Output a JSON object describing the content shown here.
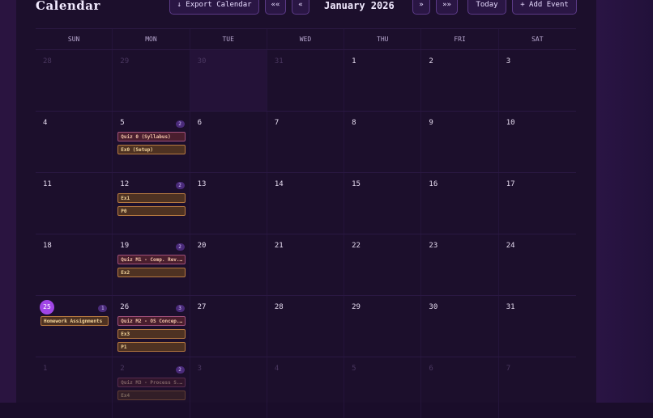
{
  "header": {
    "title": "Calendar",
    "export_label": "↓ Export Calendar",
    "prev_year_label": "««",
    "prev_month_label": "«",
    "month_label": "January 2026",
    "next_month_label": "»",
    "next_year_label": "»»",
    "today_label": "Today",
    "add_event_label": "+ Add Event"
  },
  "weekdays": [
    "SUN",
    "MON",
    "TUE",
    "WED",
    "THU",
    "FRI",
    "SAT"
  ],
  "weeks": [
    [
      "28",
      "29",
      "30",
      "31",
      "1",
      "2",
      "3"
    ],
    [
      "4",
      "5",
      "6",
      "7",
      "8",
      "9",
      "10"
    ],
    [
      "11",
      "12",
      "13",
      "14",
      "15",
      "16",
      "17"
    ],
    [
      "18",
      "19",
      "20",
      "21",
      "22",
      "23",
      "24"
    ],
    [
      "25",
      "26",
      "27",
      "28",
      "29",
      "30",
      "31"
    ],
    [
      "1",
      "2",
      "3",
      "4",
      "5",
      "6",
      "7"
    ]
  ],
  "events": {
    "w1_mon": {
      "count": "2",
      "items": [
        "Quiz 0 (Syllabus)",
        "Ex0 (Setup)"
      ]
    },
    "w2_mon": {
      "count": "2",
      "items": [
        "Ex1",
        "P0"
      ]
    },
    "w3_mon": {
      "count": "2",
      "items": [
        "Quiz M1 - Comp. Rev...",
        "Ex2"
      ]
    },
    "w4_sun": {
      "count": "1",
      "items": [
        "Homework Assignments"
      ]
    },
    "w4_mon": {
      "count": "3",
      "items": [
        "Quiz M2 - OS Concep...",
        "Ex3",
        "P1"
      ]
    },
    "w5_mon": {
      "count": "2",
      "items": [
        "Quiz M3 - Process S...",
        "Ex4"
      ]
    }
  },
  "colors": {
    "accent": "#a045e6",
    "quiz": "#a0507a",
    "exercise": "#b87a40"
  }
}
